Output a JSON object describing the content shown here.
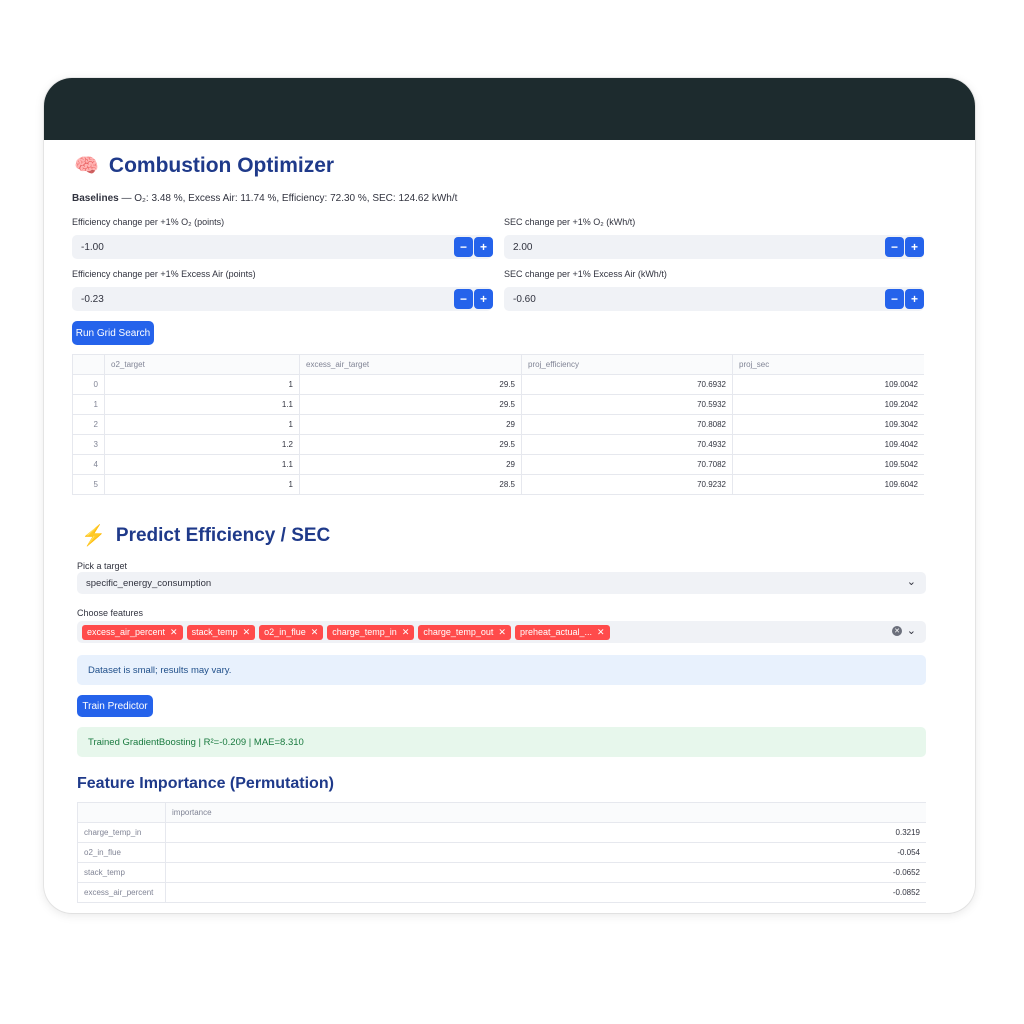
{
  "optimizer": {
    "icon": "brain-icon",
    "title": "Combustion Optimizer",
    "baselines_label": "Baselines",
    "baselines_text": " — O₂: 3.48 %, Excess Air: 11.74 %, Efficiency: 72.30 %, SEC: 124.62 kWh/t",
    "inputs": [
      {
        "label": "Efficiency change per +1% O₂ (points)",
        "value": "-1.00"
      },
      {
        "label": "SEC change per +1% O₂ (kWh/t)",
        "value": "2.00"
      },
      {
        "label": "Efficiency change per +1% Excess Air (points)",
        "value": "-0.23"
      },
      {
        "label": "SEC change per +1% Excess Air (kWh/t)",
        "value": "-0.60"
      }
    ],
    "minus_label": "−",
    "plus_label": "+",
    "run_button": "Run Grid Search",
    "table": {
      "columns": [
        "",
        "o2_target",
        "excess_air_target",
        "proj_efficiency",
        "proj_sec"
      ],
      "rows": [
        [
          "0",
          "1",
          "29.5",
          "70.6932",
          "109.0042"
        ],
        [
          "1",
          "1.1",
          "29.5",
          "70.5932",
          "109.2042"
        ],
        [
          "2",
          "1",
          "29",
          "70.8082",
          "109.3042"
        ],
        [
          "3",
          "1.2",
          "29.5",
          "70.4932",
          "109.4042"
        ],
        [
          "4",
          "1.1",
          "29",
          "70.7082",
          "109.5042"
        ],
        [
          "5",
          "1",
          "28.5",
          "70.9232",
          "109.6042"
        ]
      ]
    }
  },
  "predict": {
    "icon": "lightning-icon",
    "title": "Predict Efficiency / SEC",
    "target_label": "Pick a target",
    "target_value": "specific_energy_consumption",
    "features_label": "Choose features",
    "features": [
      "excess_air_percent",
      "stack_temp",
      "o2_in_flue",
      "charge_temp_in",
      "charge_temp_out",
      "preheat_actual_..."
    ],
    "info_text": "Dataset is small; results may vary.",
    "train_button": "Train Predictor",
    "success_text": "Trained GradientBoosting | R²=-0.209 | MAE=8.310"
  },
  "importance": {
    "title": "Feature Importance (Permutation)",
    "columns": [
      "",
      "importance"
    ],
    "rows": [
      [
        "charge_temp_in",
        "0.3219"
      ],
      [
        "o2_in_flue",
        "-0.054"
      ],
      [
        "stack_temp",
        "-0.0652"
      ],
      [
        "excess_air_percent",
        "-0.0852"
      ]
    ]
  },
  "colors": {
    "accent": "#2563eb",
    "chip": "#ff4b4b",
    "heading": "#1f3a8a",
    "topbar": "#1d2b2e"
  }
}
